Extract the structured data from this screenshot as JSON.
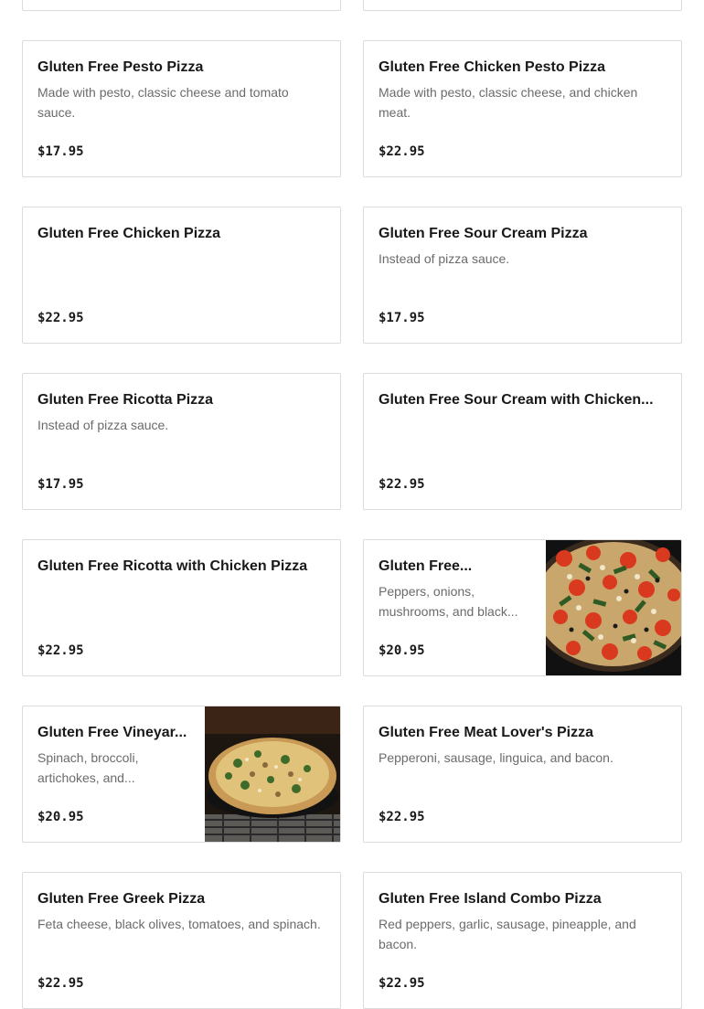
{
  "menu": {
    "items": [
      {
        "name": "",
        "description": "",
        "price": ""
      },
      {
        "name": "",
        "description": "",
        "price": ""
      },
      {
        "name": "Gluten Free Pesto Pizza",
        "description": "Made with pesto, classic cheese and tomato sauce.",
        "price": "$17.95"
      },
      {
        "name": "Gluten Free Chicken Pesto Pizza",
        "description": "Made with pesto, classic cheese, and chicken meat.",
        "price": "$22.95"
      },
      {
        "name": "Gluten Free Chicken Pizza",
        "description": "",
        "price": "$22.95"
      },
      {
        "name": "Gluten Free Sour Cream Pizza",
        "description": "Instead of pizza sauce.",
        "price": "$17.95"
      },
      {
        "name": "Gluten Free Ricotta Pizza",
        "description": "Instead of pizza sauce.",
        "price": "$17.95"
      },
      {
        "name": "Gluten Free Sour Cream with Chicken...",
        "description": "",
        "price": "$22.95"
      },
      {
        "name": "Gluten Free Ricotta with Chicken Pizza",
        "description": "",
        "price": "$22.95"
      },
      {
        "name": "Gluten Free...",
        "description": "Peppers, onions, mushrooms, and black...",
        "price": "$20.95",
        "photo": "veggie-pizza-photo"
      },
      {
        "name": "Gluten Free Vineyar...",
        "description": "Spinach, broccoli, artichokes, and...",
        "price": "$20.95",
        "photo": "vineyard-pizza-photo"
      },
      {
        "name": "Gluten Free Meat Lover's Pizza",
        "description": "Pepperoni, sausage, linguica, and bacon.",
        "price": "$22.95"
      },
      {
        "name": "Gluten Free Greek Pizza",
        "description": "Feta cheese, black olives, tomatoes, and spinach.",
        "price": "$22.95"
      },
      {
        "name": "Gluten Free Island Combo Pizza",
        "description": "Red peppers, garlic, sausage, pineapple, and bacon.",
        "price": "$22.95"
      }
    ]
  },
  "colors": {
    "card_border": "#dcdcdc",
    "title_text": "#191919",
    "description_text": "#6b6b6b",
    "background": "#ffffff"
  }
}
